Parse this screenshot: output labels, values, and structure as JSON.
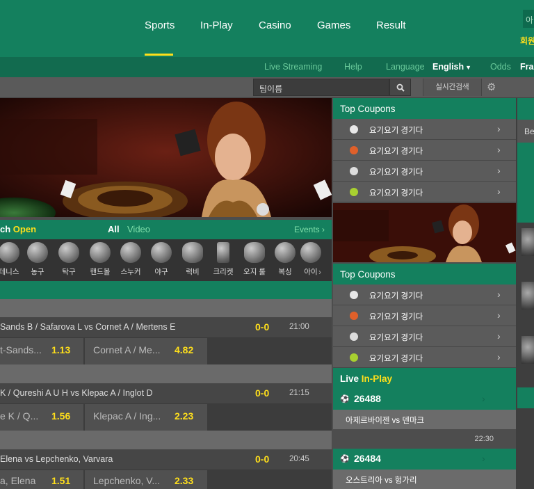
{
  "nav": {
    "items": [
      "Sports",
      "In-Play",
      "Casino",
      "Games",
      "Result"
    ],
    "user_box": "아",
    "user_link": "회원"
  },
  "subnav": {
    "live_streaming": "Live Streaming",
    "help": "Help",
    "language_label": "Language",
    "language_value": "English",
    "odds_label": "Odds",
    "odds_value": "Frac"
  },
  "search": {
    "placeholder": "팀이름",
    "realtime": "실시간검색"
  },
  "switch": {
    "title_prefix": "ch",
    "title_open": "Open",
    "tab_all": "All",
    "tab_video": "Video",
    "events": "Events"
  },
  "sports": [
    "테니스",
    "농구",
    "탁구",
    "핸드볼",
    "스누커",
    "야구",
    "럭비",
    "크리켓",
    "오지 룰",
    "복싱",
    "아이"
  ],
  "matches": [
    {
      "title": "Sands B / Safarova L vs Cornet A / Mertens E",
      "score": "0-0",
      "time": "21:00",
      "home": "t-Sands...",
      "home_odds": "1.13",
      "away": "Cornet A / Me...",
      "away_odds": "4.82"
    },
    {
      "title": "K / Qureshi A U H vs Klepac A / Inglot D",
      "score": "0-0",
      "time": "21:15",
      "home": "e K / Q...",
      "home_odds": "1.56",
      "away": "Klepac A / Ing...",
      "away_odds": "2.23"
    },
    {
      "title": "Elena vs Lepchenko, Varvara",
      "score": "0-0",
      "time": "20:45",
      "home": "a, Elena",
      "home_odds": "1.51",
      "away": "Lepchenko, V...",
      "away_odds": "2.33"
    }
  ],
  "coupons": {
    "heading": "Top Coupons",
    "items": [
      "요기요기 경기다",
      "요기요기 경기다",
      "요기요기 경기다",
      "요기요기 경기다"
    ],
    "ball_colors": [
      "#e8e8e8",
      "#e0602a",
      "#dddddd",
      "#a8d030"
    ]
  },
  "live": {
    "heading_live": "Live",
    "heading_inplay": "In-Play",
    "events": [
      {
        "id": "26488",
        "teams": "아제르바이젠 vs 덴마크",
        "time": "22:30"
      },
      {
        "id": "26484",
        "teams": "오스트리아 vs 헝가리"
      }
    ]
  },
  "farright": {
    "label": "Be"
  }
}
